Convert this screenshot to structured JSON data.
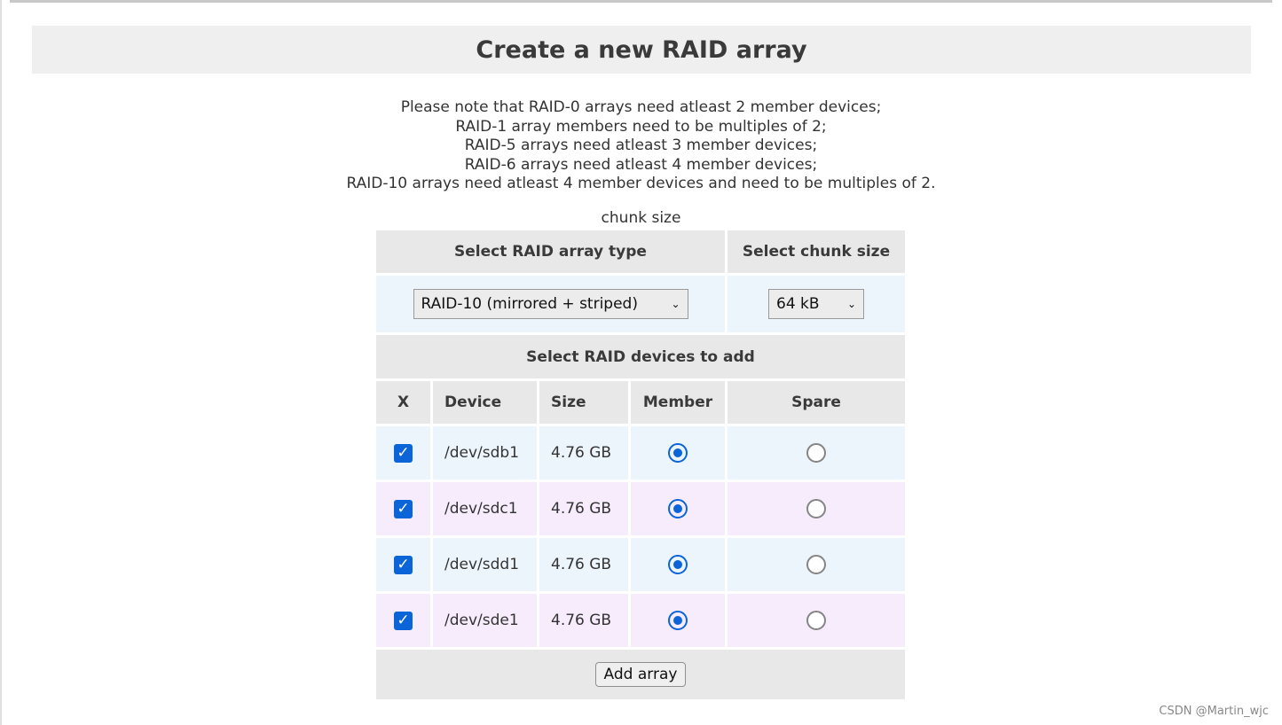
{
  "title": "Create a new RAID array",
  "notes": [
    "Please note that RAID-0 arrays need atleast 2 member devices;",
    "RAID-1 array members need to be multiples of 2;",
    "RAID-5 arrays need atleast 3 member devices;",
    "RAID-6 arrays need atleast 4 member devices;",
    "RAID-10 arrays need atleast 4 member devices and need to be multiples of 2."
  ],
  "chunk_caption": "chunk size",
  "select_type_header": "Select RAID array type",
  "select_chunk_header": "Select chunk size",
  "raid_type_value": "RAID-10 (mirrored + striped)",
  "chunk_size_value": "64 kB",
  "devices_header": "Select RAID devices to add",
  "columns": {
    "x": "X",
    "device": "Device",
    "size": "Size",
    "member": "Member",
    "spare": "Spare"
  },
  "devices": [
    {
      "device": "/dev/sdb1",
      "size": "4.76 GB",
      "checked": true,
      "role": "member"
    },
    {
      "device": "/dev/sdc1",
      "size": "4.76 GB",
      "checked": true,
      "role": "member"
    },
    {
      "device": "/dev/sdd1",
      "size": "4.76 GB",
      "checked": true,
      "role": "member"
    },
    {
      "device": "/dev/sde1",
      "size": "4.76 GB",
      "checked": true,
      "role": "member"
    }
  ],
  "add_button": "Add array",
  "watermark": "CSDN @Martin_wjc",
  "colors": {
    "accent": "#0b65d8",
    "row_blue": "#edf5fc",
    "row_purple": "#f6ecfc",
    "header_bg": "#e8e8e8"
  }
}
